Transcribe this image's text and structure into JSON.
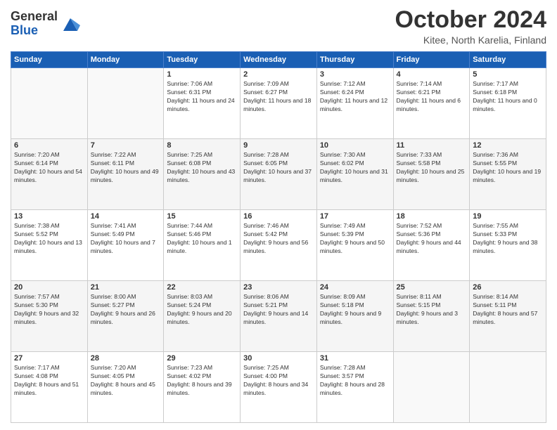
{
  "header": {
    "logo_general": "General",
    "logo_blue": "Blue",
    "month_title": "October 2024",
    "location": "Kitee, North Karelia, Finland"
  },
  "days_of_week": [
    "Sunday",
    "Monday",
    "Tuesday",
    "Wednesday",
    "Thursday",
    "Friday",
    "Saturday"
  ],
  "weeks": [
    [
      null,
      null,
      {
        "day": "1",
        "sunrise": "Sunrise: 7:06 AM",
        "sunset": "Sunset: 6:31 PM",
        "daylight": "Daylight: 11 hours and 24 minutes."
      },
      {
        "day": "2",
        "sunrise": "Sunrise: 7:09 AM",
        "sunset": "Sunset: 6:27 PM",
        "daylight": "Daylight: 11 hours and 18 minutes."
      },
      {
        "day": "3",
        "sunrise": "Sunrise: 7:12 AM",
        "sunset": "Sunset: 6:24 PM",
        "daylight": "Daylight: 11 hours and 12 minutes."
      },
      {
        "day": "4",
        "sunrise": "Sunrise: 7:14 AM",
        "sunset": "Sunset: 6:21 PM",
        "daylight": "Daylight: 11 hours and 6 minutes."
      },
      {
        "day": "5",
        "sunrise": "Sunrise: 7:17 AM",
        "sunset": "Sunset: 6:18 PM",
        "daylight": "Daylight: 11 hours and 0 minutes."
      }
    ],
    [
      {
        "day": "6",
        "sunrise": "Sunrise: 7:20 AM",
        "sunset": "Sunset: 6:14 PM",
        "daylight": "Daylight: 10 hours and 54 minutes."
      },
      {
        "day": "7",
        "sunrise": "Sunrise: 7:22 AM",
        "sunset": "Sunset: 6:11 PM",
        "daylight": "Daylight: 10 hours and 49 minutes."
      },
      {
        "day": "8",
        "sunrise": "Sunrise: 7:25 AM",
        "sunset": "Sunset: 6:08 PM",
        "daylight": "Daylight: 10 hours and 43 minutes."
      },
      {
        "day": "9",
        "sunrise": "Sunrise: 7:28 AM",
        "sunset": "Sunset: 6:05 PM",
        "daylight": "Daylight: 10 hours and 37 minutes."
      },
      {
        "day": "10",
        "sunrise": "Sunrise: 7:30 AM",
        "sunset": "Sunset: 6:02 PM",
        "daylight": "Daylight: 10 hours and 31 minutes."
      },
      {
        "day": "11",
        "sunrise": "Sunrise: 7:33 AM",
        "sunset": "Sunset: 5:58 PM",
        "daylight": "Daylight: 10 hours and 25 minutes."
      },
      {
        "day": "12",
        "sunrise": "Sunrise: 7:36 AM",
        "sunset": "Sunset: 5:55 PM",
        "daylight": "Daylight: 10 hours and 19 minutes."
      }
    ],
    [
      {
        "day": "13",
        "sunrise": "Sunrise: 7:38 AM",
        "sunset": "Sunset: 5:52 PM",
        "daylight": "Daylight: 10 hours and 13 minutes."
      },
      {
        "day": "14",
        "sunrise": "Sunrise: 7:41 AM",
        "sunset": "Sunset: 5:49 PM",
        "daylight": "Daylight: 10 hours and 7 minutes."
      },
      {
        "day": "15",
        "sunrise": "Sunrise: 7:44 AM",
        "sunset": "Sunset: 5:46 PM",
        "daylight": "Daylight: 10 hours and 1 minute."
      },
      {
        "day": "16",
        "sunrise": "Sunrise: 7:46 AM",
        "sunset": "Sunset: 5:42 PM",
        "daylight": "Daylight: 9 hours and 56 minutes."
      },
      {
        "day": "17",
        "sunrise": "Sunrise: 7:49 AM",
        "sunset": "Sunset: 5:39 PM",
        "daylight": "Daylight: 9 hours and 50 minutes."
      },
      {
        "day": "18",
        "sunrise": "Sunrise: 7:52 AM",
        "sunset": "Sunset: 5:36 PM",
        "daylight": "Daylight: 9 hours and 44 minutes."
      },
      {
        "day": "19",
        "sunrise": "Sunrise: 7:55 AM",
        "sunset": "Sunset: 5:33 PM",
        "daylight": "Daylight: 9 hours and 38 minutes."
      }
    ],
    [
      {
        "day": "20",
        "sunrise": "Sunrise: 7:57 AM",
        "sunset": "Sunset: 5:30 PM",
        "daylight": "Daylight: 9 hours and 32 minutes."
      },
      {
        "day": "21",
        "sunrise": "Sunrise: 8:00 AM",
        "sunset": "Sunset: 5:27 PM",
        "daylight": "Daylight: 9 hours and 26 minutes."
      },
      {
        "day": "22",
        "sunrise": "Sunrise: 8:03 AM",
        "sunset": "Sunset: 5:24 PM",
        "daylight": "Daylight: 9 hours and 20 minutes."
      },
      {
        "day": "23",
        "sunrise": "Sunrise: 8:06 AM",
        "sunset": "Sunset: 5:21 PM",
        "daylight": "Daylight: 9 hours and 14 minutes."
      },
      {
        "day": "24",
        "sunrise": "Sunrise: 8:09 AM",
        "sunset": "Sunset: 5:18 PM",
        "daylight": "Daylight: 9 hours and 9 minutes."
      },
      {
        "day": "25",
        "sunrise": "Sunrise: 8:11 AM",
        "sunset": "Sunset: 5:15 PM",
        "daylight": "Daylight: 9 hours and 3 minutes."
      },
      {
        "day": "26",
        "sunrise": "Sunrise: 8:14 AM",
        "sunset": "Sunset: 5:11 PM",
        "daylight": "Daylight: 8 hours and 57 minutes."
      }
    ],
    [
      {
        "day": "27",
        "sunrise": "Sunrise: 7:17 AM",
        "sunset": "Sunset: 4:08 PM",
        "daylight": "Daylight: 8 hours and 51 minutes."
      },
      {
        "day": "28",
        "sunrise": "Sunrise: 7:20 AM",
        "sunset": "Sunset: 4:05 PM",
        "daylight": "Daylight: 8 hours and 45 minutes."
      },
      {
        "day": "29",
        "sunrise": "Sunrise: 7:23 AM",
        "sunset": "Sunset: 4:02 PM",
        "daylight": "Daylight: 8 hours and 39 minutes."
      },
      {
        "day": "30",
        "sunrise": "Sunrise: 7:25 AM",
        "sunset": "Sunset: 4:00 PM",
        "daylight": "Daylight: 8 hours and 34 minutes."
      },
      {
        "day": "31",
        "sunrise": "Sunrise: 7:28 AM",
        "sunset": "Sunset: 3:57 PM",
        "daylight": "Daylight: 8 hours and 28 minutes."
      },
      null,
      null
    ]
  ]
}
